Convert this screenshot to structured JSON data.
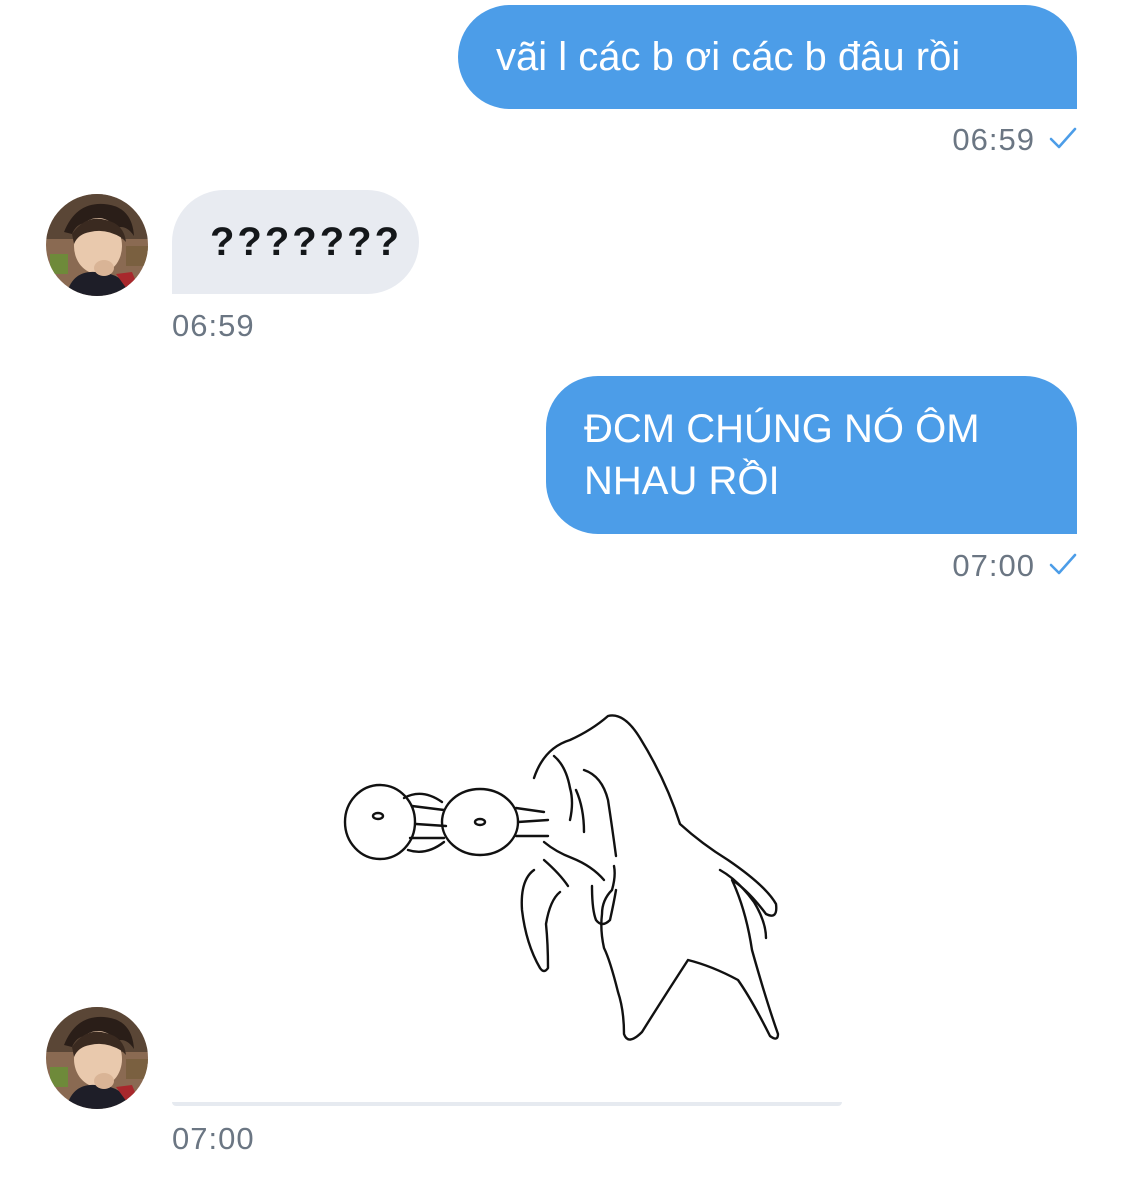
{
  "conversation": {
    "messages": [
      {
        "direction": "outgoing",
        "text": "vãi l các b ơi các b đâu rồi",
        "time": "06:59",
        "status_icon": "sent-check-icon"
      },
      {
        "direction": "incoming",
        "text": "???????",
        "time": "06:59",
        "avatar_icon": "user-avatar"
      },
      {
        "direction": "outgoing",
        "text_lines": [
          "ĐCM CHÚNG NÓ ÔM",
          "NHAU RỒI"
        ],
        "time": "07:00",
        "status_icon": "sent-check-icon"
      },
      {
        "direction": "incoming",
        "media": "line-drawing-image",
        "time": "07:00",
        "avatar_icon": "user-avatar"
      }
    ]
  },
  "colors": {
    "outgoing_bubble": "#4c9de8",
    "incoming_bubble": "#e8ebf1",
    "timestamp": "#6b7683",
    "check": "#4c9de8"
  }
}
